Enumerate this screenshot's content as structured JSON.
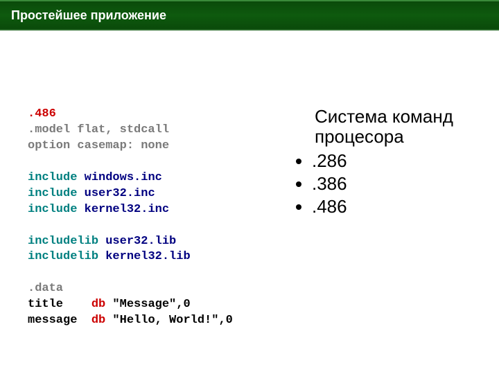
{
  "header": {
    "title": "Простейшее приложение"
  },
  "code": {
    "l1": ".486",
    "l2a": ".model",
    "l2b": " flat, stdcall",
    "l3a": "option",
    "l3b": " casemap: none",
    "l5a": "include",
    "l5b": " windows.inc",
    "l6a": "include",
    "l6b": " user32.inc",
    "l7a": "include",
    "l7b": " kernel32.inc",
    "l9a": "includelib",
    "l9b": " user32.lib",
    "l10a": "includelib",
    "l10b": " kernel32.lib",
    "l12": ".data",
    "l13a": "title",
    "l13b": "db",
    "l13c": " \"Message\",0",
    "l14a": "message",
    "l14b": "db",
    "l14c": " \"Hello, World!\",0"
  },
  "right": {
    "heading": "Система команд процесора",
    "items": [
      ".286",
      ".386",
      ".486"
    ]
  }
}
